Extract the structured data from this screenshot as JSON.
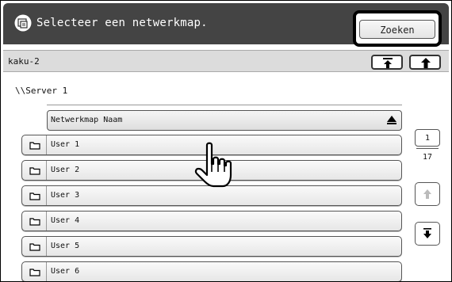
{
  "header": {
    "title": "Selecteer een netwerkmap.",
    "search_label": "Zoeken"
  },
  "path": {
    "current": "kaku-2"
  },
  "server": "\\\\Server 1",
  "list": {
    "column_header": "Netwerkmap Naam",
    "items": [
      {
        "label": "User 1"
      },
      {
        "label": "User 2"
      },
      {
        "label": "User 3"
      },
      {
        "label": "User 4"
      },
      {
        "label": "User 5"
      },
      {
        "label": "User 6"
      }
    ]
  },
  "pager": {
    "current": "1",
    "total": "17"
  },
  "icons": {
    "header": "copier-icon",
    "nav_up_top": "up-arrow-top-icon",
    "nav_up": "up-arrow-icon",
    "folder": "folder-icon",
    "sort": "sort-ascending-icon",
    "scroll_up": "scroll-up-icon",
    "scroll_down": "scroll-down-icon",
    "pointer": "hand-pointer-icon"
  }
}
